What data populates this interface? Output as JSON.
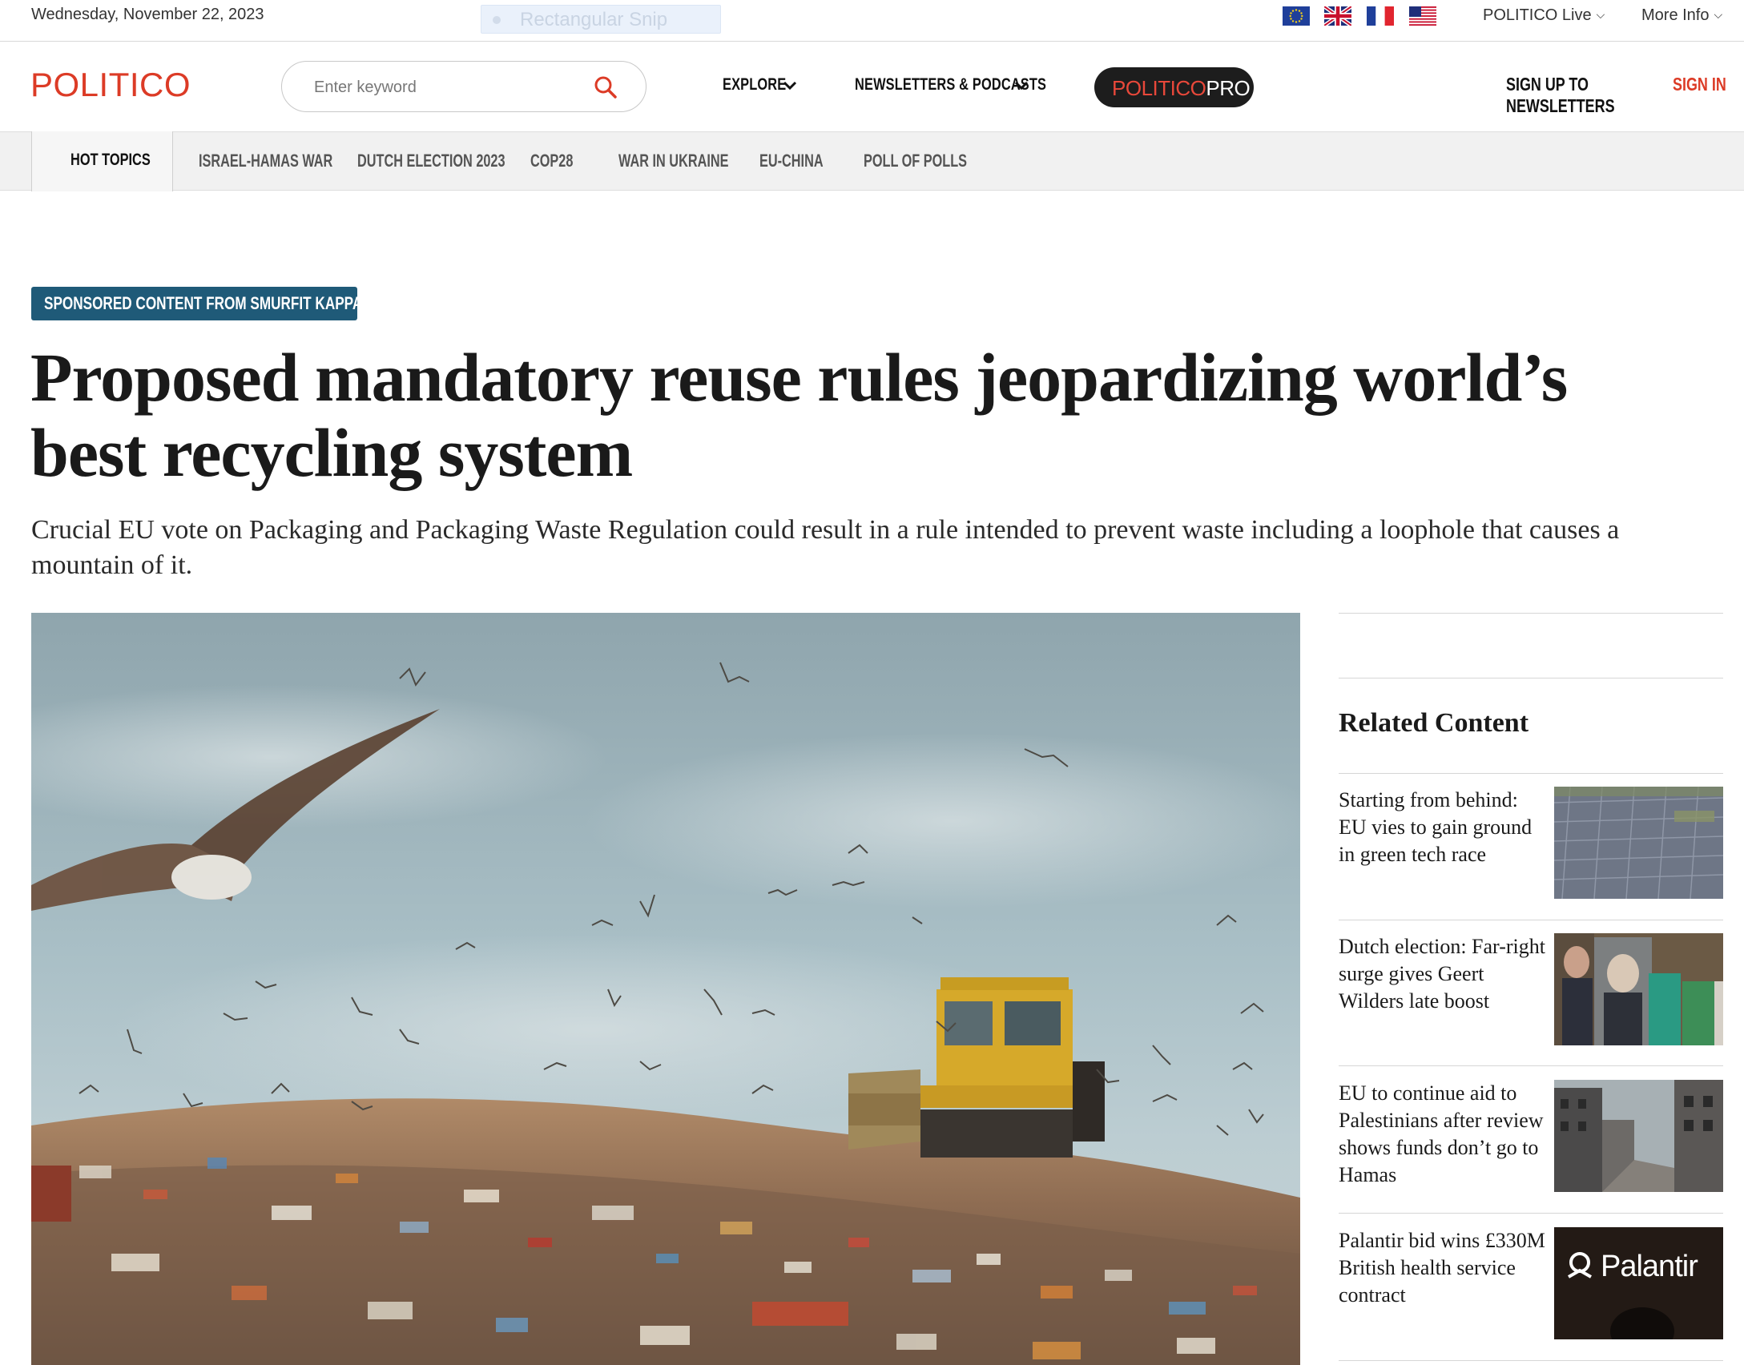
{
  "utility": {
    "date": "Wednesday, November 22, 2023",
    "snip_label": "Rectangular Snip",
    "live_label": "POLITICO Live",
    "more_label": "More Info"
  },
  "header": {
    "logo": "POLITICO",
    "search_placeholder": "Enter keyword",
    "explore_label": "EXPLORE",
    "newsletters_label": "NEWSLETTERS & PODCASTS",
    "pro_brand": "POLITICO",
    "pro_suffix": "PRO",
    "signup_label": "SIGN UP TO NEWSLETTERS",
    "signin_label": "SIGN IN"
  },
  "topics": {
    "hot_label": "HOT TOPICS",
    "items": [
      "ISRAEL-HAMAS WAR",
      "DUTCH ELECTION 2023",
      "COP28",
      "WAR IN UKRAINE",
      "EU-CHINA",
      "POLL OF POLLS"
    ]
  },
  "article": {
    "sponsor": "SPONSORED CONTENT FROM SMURFIT KAPPA",
    "headline": "Proposed mandatory reuse rules jeopardizing world’s best recycling system",
    "dek": "Crucial EU vote on Packaging and Packaging Waste Regulation could result in a rule intended to prevent waste including a loophole that causes a mountain of it."
  },
  "sidebar": {
    "title": "Related Content",
    "items": [
      {
        "text": "Starting from behind: EU vies to gain ground in green tech race"
      },
      {
        "text": "Dutch election: Far-right surge gives Geert Wilders late boost"
      },
      {
        "text": "EU to continue aid to Palestinians after review shows funds don’t go to Hamas"
      },
      {
        "text": "Palantir bid wins £330M British health service contract"
      }
    ],
    "palantir_logo": "Palantir"
  },
  "colors": {
    "brand_red": "#dc3b26",
    "sponsor_teal": "#1f5a78",
    "pro_pill": "#1d1d1d"
  },
  "icons": {
    "search": "magnifier-icon",
    "chevron": "chevron-down-icon",
    "flags": [
      "eu-flag-icon",
      "uk-flag-icon",
      "france-flag-icon",
      "us-flag-icon"
    ]
  }
}
